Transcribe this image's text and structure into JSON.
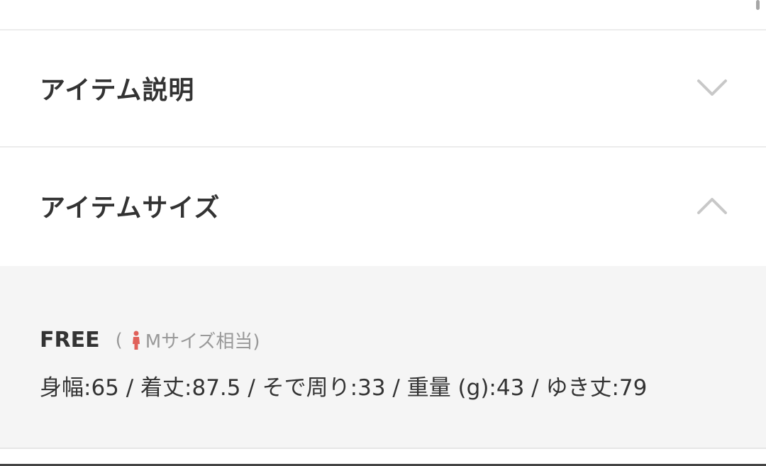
{
  "sections": {
    "item_description": {
      "title": "アイテム説明",
      "expanded": false,
      "icon": "chevron-down-icon"
    },
    "item_size": {
      "title": "アイテムサイズ",
      "expanded": true,
      "icon": "chevron-up-icon"
    }
  },
  "size_panel": {
    "size_name": "FREE",
    "ref_open": "(",
    "ref_label": "Mサイズ相当)",
    "ref_icon": "person-icon",
    "measurements": "身幅:65 / 着丈:87.5 / そで周り:33 / 重量 (g):43 / ゆき丈:79"
  },
  "colors": {
    "text": "#333333",
    "muted": "#999999",
    "chevron": "#c8c8c8",
    "panel_bg": "#f5f5f5",
    "person_icon": "#e0615a"
  }
}
